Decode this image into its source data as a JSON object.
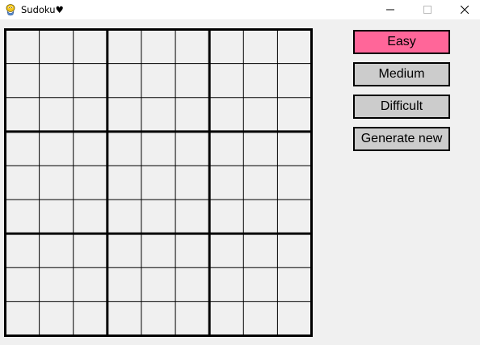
{
  "window": {
    "title": "Sudoku♥",
    "icon": "pygame-snake-icon"
  },
  "board": {
    "rows": 9,
    "cols": 9,
    "cells": [
      [
        "",
        "",
        "",
        "",
        "",
        "",
        "",
        "",
        ""
      ],
      [
        "",
        "",
        "",
        "",
        "",
        "",
        "",
        "",
        ""
      ],
      [
        "",
        "",
        "",
        "",
        "",
        "",
        "",
        "",
        ""
      ],
      [
        "",
        "",
        "",
        "",
        "",
        "",
        "",
        "",
        ""
      ],
      [
        "",
        "",
        "",
        "",
        "",
        "",
        "",
        "",
        ""
      ],
      [
        "",
        "",
        "",
        "",
        "",
        "",
        "",
        "",
        ""
      ],
      [
        "",
        "",
        "",
        "",
        "",
        "",
        "",
        "",
        ""
      ],
      [
        "",
        "",
        "",
        "",
        "",
        "",
        "",
        "",
        ""
      ],
      [
        "",
        "",
        "",
        "",
        "",
        "",
        "",
        "",
        ""
      ]
    ]
  },
  "difficulty": {
    "selected": "Easy",
    "easy_label": "Easy",
    "medium_label": "Medium",
    "difficult_label": "Difficult",
    "generate_label": "Generate new"
  },
  "colors": {
    "active_button": "#ff6699",
    "inactive_button": "#cccccc",
    "background": "#f0f0f0",
    "grid": "#000000"
  }
}
